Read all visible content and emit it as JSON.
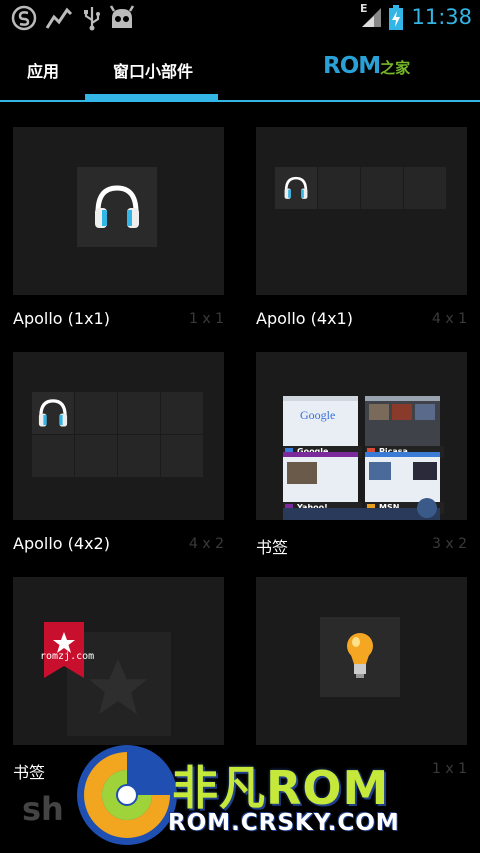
{
  "status_bar": {
    "time": "11:38",
    "left_icons": [
      "s-circle-icon",
      "activity-graph-icon",
      "usb-icon",
      "android-robot-icon"
    ],
    "right_icons": [
      "signal-icon",
      "battery-charging-icon"
    ],
    "signal_label": "E"
  },
  "tabs": [
    {
      "label": "应用",
      "selected": false
    },
    {
      "label": "窗口小部件",
      "selected": true
    }
  ],
  "brand": {
    "part1": "ROM",
    "part2": "之家"
  },
  "widgets": [
    {
      "name": "Apollo (1x1)",
      "dims": "1 x 1",
      "icon": "headphones-icon"
    },
    {
      "name": "Apollo (4x1)",
      "dims": "4 x 1",
      "icon": "headphones-icon"
    },
    {
      "name": "Apollo (4x2)",
      "dims": "4 x 2",
      "icon": "headphones-icon"
    },
    {
      "name": "书签",
      "dims": "3 x 2",
      "icon": "bookmark-thumbnails",
      "thumbs": [
        "Google",
        "Picasa",
        "Yahoo!",
        "MSN"
      ]
    },
    {
      "name": "书签",
      "dims": "",
      "icon": "bookmark-star-icon"
    },
    {
      "name": "",
      "dims": "1 x 1",
      "icon": "lightbulb-icon"
    }
  ],
  "watermark": {
    "line1": "非凡ROM",
    "line2": "ROM.CRSKY.COM",
    "romzj": "romzj.com",
    "sh": "sh"
  },
  "colors": {
    "accent": "#33b5e5",
    "background": "#000000",
    "tile": "#1b1b1b"
  }
}
